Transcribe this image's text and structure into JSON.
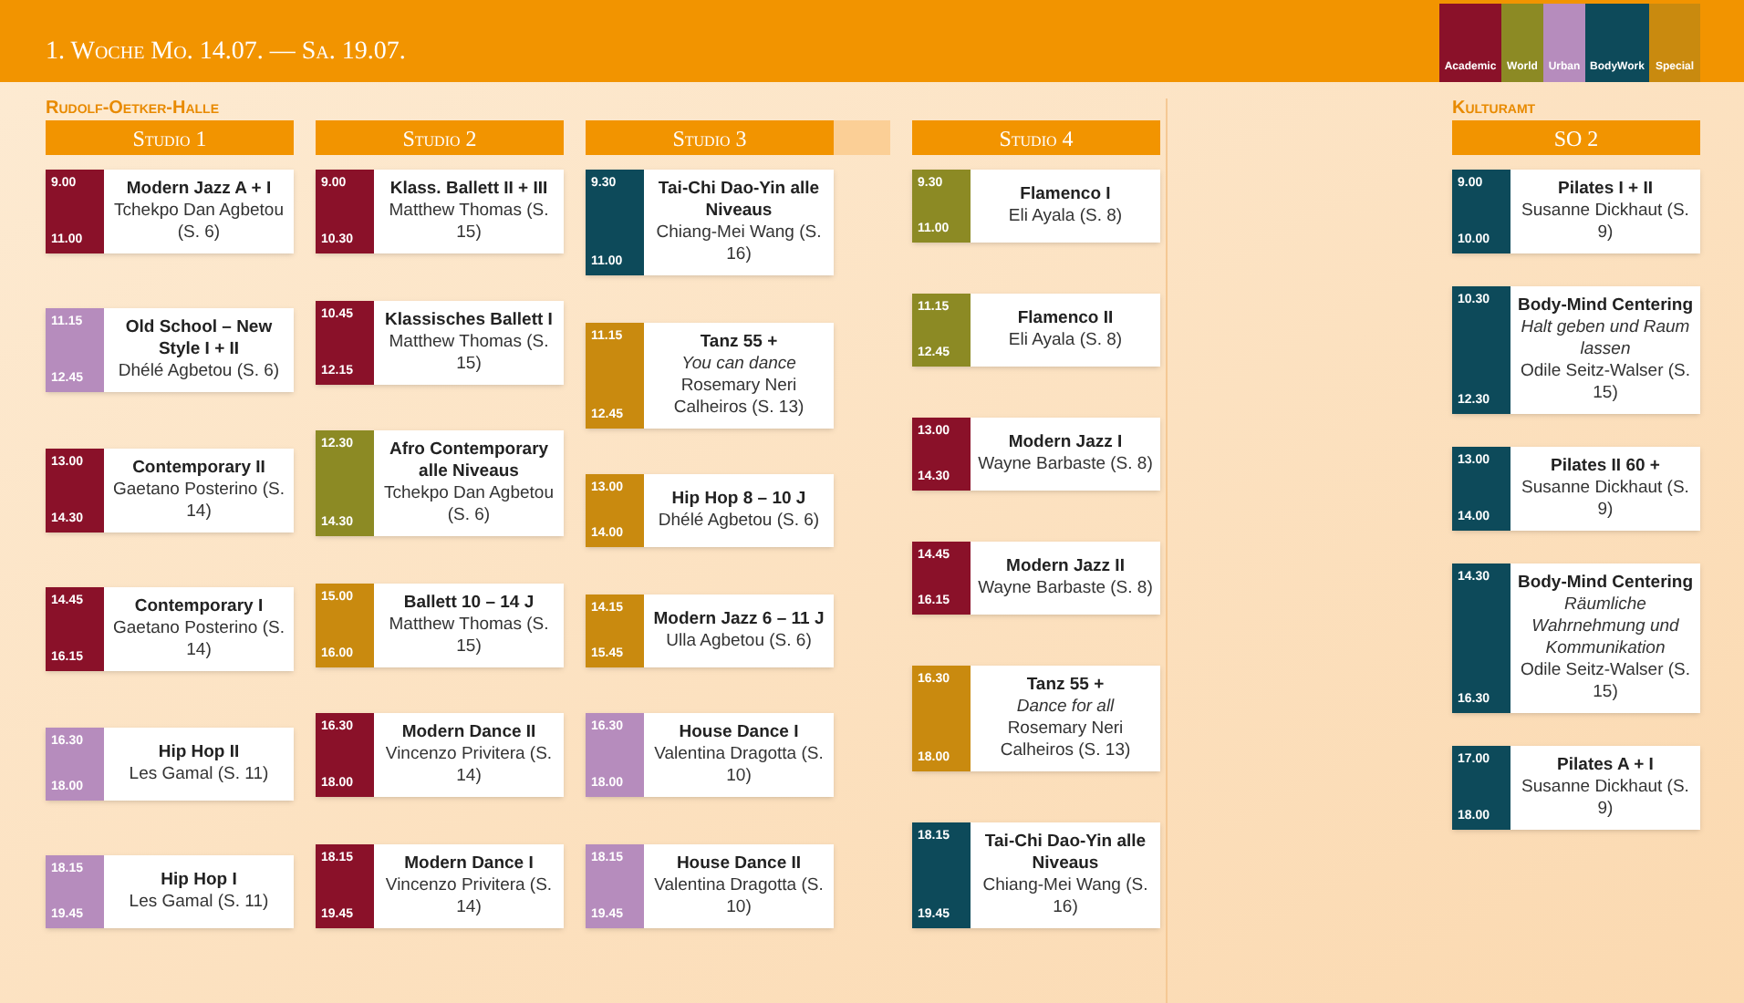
{
  "header": {
    "title": "1. Woche Mo. 14.07. — Sa. 19.07."
  },
  "legend": [
    {
      "label": "Academic",
      "kind": "academic",
      "color": "#8a1129"
    },
    {
      "label": "World",
      "kind": "world",
      "color": "#8c8a24"
    },
    {
      "label": "Urban",
      "kind": "urban",
      "color": "#b68cbd"
    },
    {
      "label": "BodyWork",
      "kind": "bodywork",
      "color": "#0d4a5a"
    },
    {
      "label": "Special",
      "kind": "special",
      "color": "#c98a0f"
    }
  ],
  "venues": [
    {
      "name": "Rudolf-Oetker-Halle",
      "rooms": [
        {
          "name": "Studio 1",
          "classes": [
            {
              "kind": "academic",
              "start": "9.00",
              "end": "11.00",
              "title": "Modern Jazz A + I",
              "details": "Tchekpo Dan Agbetou (S. 6)"
            },
            {
              "kind": "urban",
              "start": "11.15",
              "end": "12.45",
              "title": "Old School – New Style I + II",
              "details": "Dhélé Agbetou (S. 6)"
            },
            {
              "kind": "academic",
              "start": "13.00",
              "end": "14.30",
              "title": "Contemporary II",
              "details": "Gaetano Posterino (S. 14)"
            },
            {
              "kind": "academic",
              "start": "14.45",
              "end": "16.15",
              "title": "Contemporary I",
              "details": "Gaetano Posterino (S. 14)"
            },
            {
              "kind": "urban",
              "start": "16.30",
              "end": "18.00",
              "title": "Hip Hop II",
              "details": "Les Gamal (S. 11)"
            },
            {
              "kind": "urban",
              "start": "18.15",
              "end": "19.45",
              "title": "Hip Hop I",
              "details": "Les Gamal (S. 11)"
            }
          ]
        },
        {
          "name": "Studio 2",
          "classes": [
            {
              "kind": "academic",
              "start": "9.00",
              "end": "10.30",
              "title": "Klass. Ballett II + III",
              "details": "Matthew Thomas (S. 15)"
            },
            {
              "kind": "academic",
              "start": "10.45",
              "end": "12.15",
              "title": "Klassisches Ballett I",
              "details": "Matthew Thomas (S. 15)"
            },
            {
              "kind": "world",
              "start": "12.30",
              "end": "14.30",
              "title": "Afro Contemporary alle Niveaus",
              "details": "Tchekpo Dan Agbetou (S. 6)"
            },
            {
              "kind": "special",
              "start": "15.00",
              "end": "16.00",
              "title": "Ballett 10 – 14 J",
              "details": "Matthew Thomas (S. 15)"
            },
            {
              "kind": "academic",
              "start": "16.30",
              "end": "18.00",
              "title": "Modern Dance II",
              "details": "Vincenzo Privitera (S. 14)"
            },
            {
              "kind": "academic",
              "start": "18.15",
              "end": "19.45",
              "title": "Modern Dance I",
              "details": "Vincenzo Privitera (S. 14)"
            }
          ]
        },
        {
          "name": "Studio 3",
          "classes": [
            {
              "kind": "bodywork",
              "start": "9.30",
              "end": "11.00",
              "title": "Tai-Chi Dao-Yin alle Niveaus",
              "details": "Chiang-Mei Wang (S. 16)"
            },
            {
              "kind": "special",
              "start": "11.15",
              "end": "12.45",
              "title": "Tanz 55 +",
              "subtitle": "You can dance",
              "details": "Rosemary Neri Calheiros (S. 13)"
            },
            {
              "kind": "special",
              "start": "13.00",
              "end": "14.00",
              "title": "Hip Hop 8 – 10 J",
              "details": "Dhélé Agbetou (S. 6)"
            },
            {
              "kind": "special",
              "start": "14.15",
              "end": "15.45",
              "title": "Modern Jazz 6 – 11 J",
              "details": "Ulla Agbetou (S. 6)"
            },
            {
              "kind": "urban",
              "start": "16.30",
              "end": "18.00",
              "title": "House Dance I",
              "details": "Valentina Dragotta (S. 10)"
            },
            {
              "kind": "urban",
              "start": "18.15",
              "end": "19.45",
              "title": "House Dance II",
              "details": "Valentina Dragotta (S. 10)"
            }
          ]
        },
        {
          "name": "Studio 4",
          "classes": [
            {
              "kind": "world",
              "start": "9.30",
              "end": "11.00",
              "title": "Flamenco I",
              "details": "Eli Ayala (S. 8)"
            },
            {
              "kind": "world",
              "start": "11.15",
              "end": "12.45",
              "title": "Flamenco II",
              "details": "Eli Ayala (S. 8)"
            },
            {
              "kind": "academic",
              "start": "13.00",
              "end": "14.30",
              "title": "Modern Jazz I",
              "details": "Wayne Barbaste (S. 8)"
            },
            {
              "kind": "academic",
              "start": "14.45",
              "end": "16.15",
              "title": "Modern Jazz II",
              "details": "Wayne Barbaste (S. 8)"
            },
            {
              "kind": "special",
              "start": "16.30",
              "end": "18.00",
              "title": "Tanz 55 +",
              "subtitle": "Dance for all",
              "details": "Rosemary Neri Calheiros (S. 13)"
            },
            {
              "kind": "bodywork",
              "start": "18.15",
              "end": "19.45",
              "title": "Tai-Chi Dao-Yin alle Niveaus",
              "details": "Chiang-Mei Wang (S. 16)"
            }
          ]
        }
      ]
    },
    {
      "name": "Kulturamt",
      "rooms": [
        {
          "name": "SO 2",
          "classes": [
            {
              "kind": "bodywork",
              "start": "9.00",
              "end": "10.00",
              "title": "Pilates I + II",
              "details": "Susanne Dickhaut (S. 9)"
            },
            {
              "kind": "bodywork",
              "start": "10.30",
              "end": "12.30",
              "title": "Body-Mind Centering",
              "subtitle": "Halt geben und Raum lassen",
              "details": "Odile Seitz-Walser (S. 15)"
            },
            {
              "kind": "bodywork",
              "start": "13.00",
              "end": "14.00",
              "title": "Pilates II 60 +",
              "details": "Susanne Dickhaut (S. 9)"
            },
            {
              "kind": "bodywork",
              "start": "14.30",
              "end": "16.30",
              "title": "Body-Mind Centering",
              "subtitle": "Räumliche Wahrnehmung und Kommunikation",
              "details": "Odile Seitz-Walser (S. 15)"
            },
            {
              "kind": "bodywork",
              "start": "17.00",
              "end": "18.00",
              "title": "Pilates A + I",
              "details": "Susanne Dickhaut (S. 9)"
            }
          ]
        }
      ]
    }
  ]
}
